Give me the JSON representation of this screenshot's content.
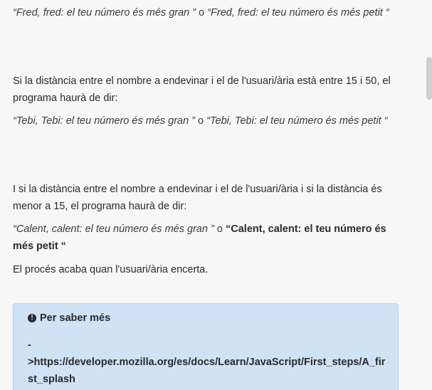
{
  "paragraphs": {
    "p1": {
      "quote1": "“Fred, fred: el teu número és més gran ”",
      "sep": " o ",
      "quote2": "“Fred, fred: el teu número és més petit “"
    },
    "p2": "Si la distància entre el nombre a endevinar i el de l'usuari/ària està entre 15 i 50, el programa haurà de dir:",
    "p3": {
      "quote1": "“Tebi, Tebi: el teu número és més gran ”",
      "sep": " o ",
      "quote2": "“Tebi, Tebi: el teu número és més petit “"
    },
    "p4": "I si la distància entre el nombre a endevinar i el de l'usuari/ària i si la distància és menor a 15, el programa haurà de dir:",
    "p5": {
      "quote1": "“Calent, calent: el teu número és més gran ”",
      "sep": " o ",
      "quote2": "“Calent, calent: el teu número és més petit “"
    },
    "p6": "El procés acaba quan l'usuari/ària encerta."
  },
  "info_box": {
    "icon": "exclamation-circle-icon",
    "title": "Per saber més",
    "dash": "-",
    "link": ">https://developer.mozilla.org/es/docs/Learn/JavaScript/First_steps/A_first_splash"
  }
}
